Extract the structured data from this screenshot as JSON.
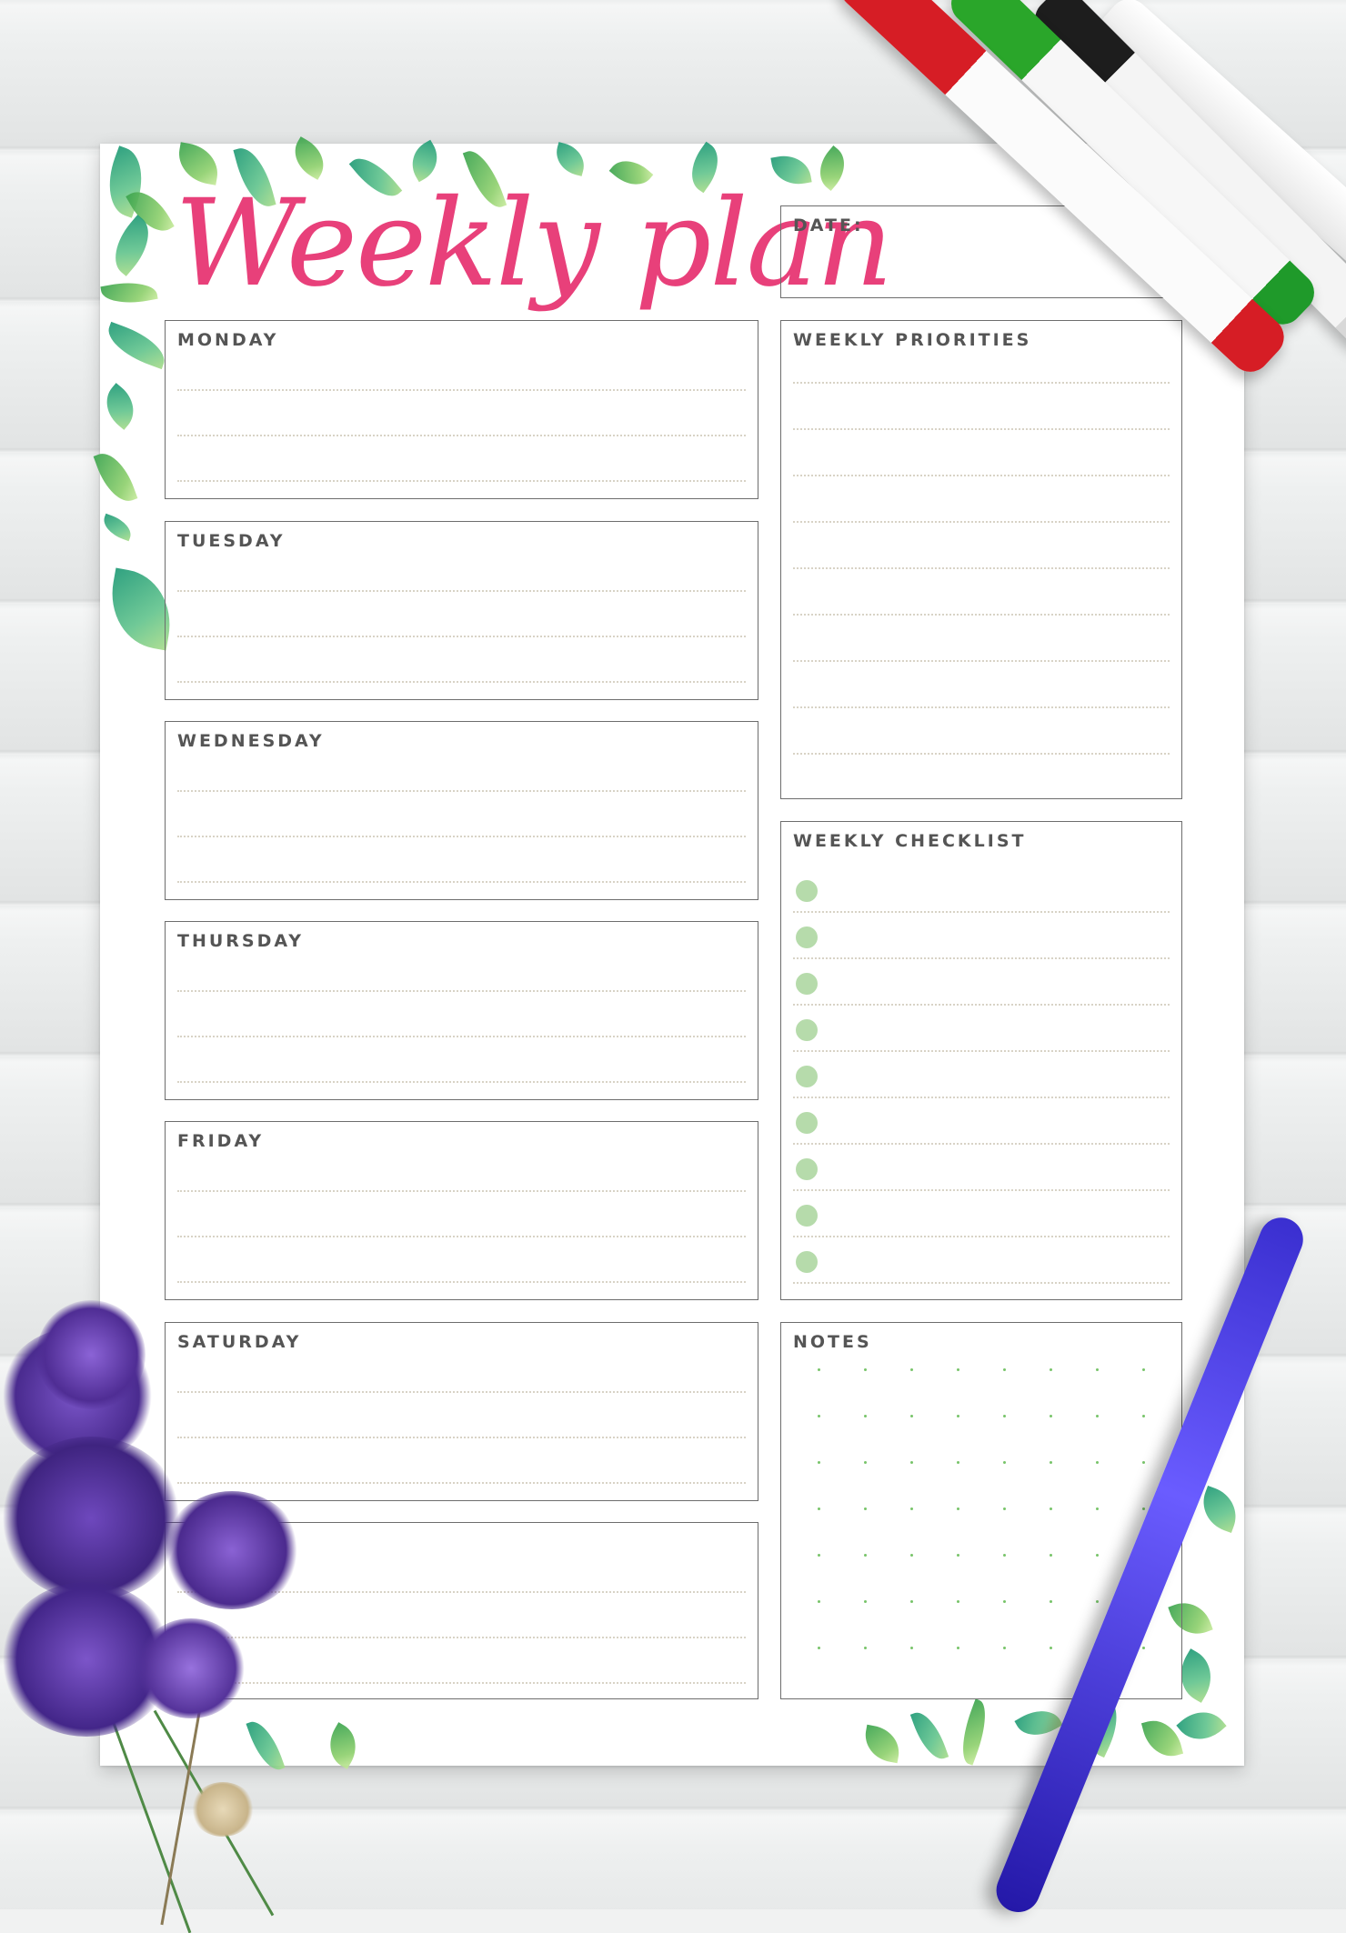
{
  "title": "Weekly plan",
  "date_label": "DATE:",
  "days": [
    "MONDAY",
    "TUESDAY",
    "WEDNESDAY",
    "THURSDAY",
    "FRIDAY",
    "SATURDAY"
  ],
  "priorities_label": "WEEKLY PRIORITIES",
  "checklist_label": "WEEKLY CHECKLIST",
  "notes_label": "NOTES",
  "colors": {
    "title": "#e8407a",
    "border": "#6d6d6d",
    "label": "#555555",
    "checkbox": "#b6dbab",
    "dot_grid": "#78c46a"
  }
}
